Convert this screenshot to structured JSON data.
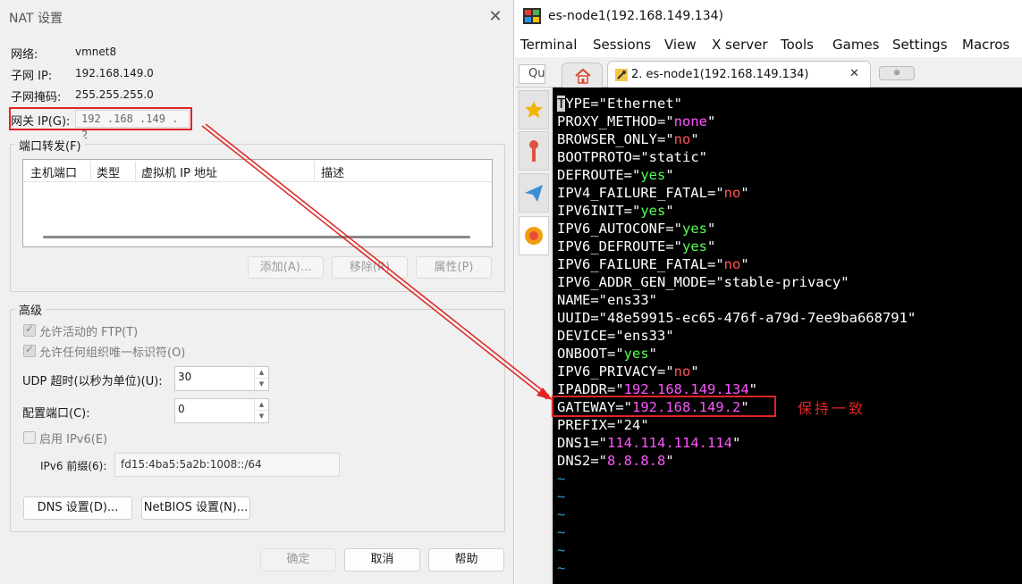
{
  "nat_dialog": {
    "title": "NAT 设置",
    "close_glyph": "✕",
    "network_label": "网络:",
    "network_value": "vmnet8",
    "subnet_ip_label": "子网 IP:",
    "subnet_ip_value": "192.168.149.0",
    "subnet_mask_label": "子网掩码:",
    "subnet_mask_value": "255.255.255.0",
    "gateway_label": "网关 IP(G):",
    "gateway_value": "192 .168 .149 . 2",
    "port_forward": {
      "group_title": "端口转发(F)",
      "columns": [
        "主机端口",
        "类型",
        "虚拟机 IP 地址",
        "描述"
      ],
      "add_button": "添加(A)...",
      "remove_button": "移除(R)",
      "properties_button": "属性(P)"
    },
    "advanced": {
      "group_title": "高级",
      "allow_ftp_label": "允许活动的 FTP(T)",
      "allow_ftp_checked": true,
      "allow_oui_label": "允许任何组织唯一标识符(O)",
      "allow_oui_checked": true,
      "udp_timeout_label": "UDP 超时(以秒为单位)(U):",
      "udp_timeout_value": "30",
      "config_port_label": "配置端口(C):",
      "config_port_value": "0",
      "enable_ipv6_label": "启用 IPv6(E)",
      "enable_ipv6_checked": false,
      "ipv6_prefix_label": "IPv6 前缀(6):",
      "ipv6_prefix_value": "fd15:4ba5:5a2b:1008::/64",
      "dns_button": "DNS 设置(D)...",
      "netbios_button": "NetBIOS 设置(N)..."
    },
    "ok_button": "确定",
    "cancel_button": "取消",
    "help_button": "帮助"
  },
  "moba": {
    "window_title": "es-node1(192.168.149.134)",
    "menu": [
      "Terminal",
      "Sessions",
      "View",
      "X server",
      "Tools",
      "Games",
      "Settings",
      "Macros"
    ],
    "quick_connect": "Qu",
    "active_tab_label": "2. es-node1(192.168.149.134)",
    "tab_close_glyph": "✕",
    "new_tab_glyph": "⊕",
    "terminal_lines": [
      {
        "key": "TYPE=",
        "val": "\"Ethernet\"",
        "color": "#ffffff"
      },
      {
        "key": "PROXY_METHOD=",
        "val": "\"none\"",
        "color": "#ff55ff",
        "quote_white": true
      },
      {
        "key": "BROWSER_ONLY=",
        "val": "\"no\"",
        "color": "#ff5555",
        "quote_white": true
      },
      {
        "key": "BOOTPROTO=",
        "val": "\"static\"",
        "color": "#ffffff"
      },
      {
        "key": "DEFROUTE=",
        "val": "\"yes\"",
        "color": "#55ff55",
        "quote_white": true
      },
      {
        "key": "IPV4_FAILURE_FATAL=",
        "val": "\"no\"",
        "color": "#ff5555",
        "quote_white": true
      },
      {
        "key": "IPV6INIT=",
        "val": "\"yes\"",
        "color": "#55ff55",
        "quote_white": true
      },
      {
        "key": "IPV6_AUTOCONF=",
        "val": "\"yes\"",
        "color": "#55ff55",
        "quote_white": true
      },
      {
        "key": "IPV6_DEFROUTE=",
        "val": "\"yes\"",
        "color": "#55ff55",
        "quote_white": true
      },
      {
        "key": "IPV6_FAILURE_FATAL=",
        "val": "\"no\"",
        "color": "#ff5555",
        "quote_white": true
      },
      {
        "key": "IPV6_ADDR_GEN_MODE=",
        "val": "\"stable-privacy\"",
        "color": "#ffffff"
      },
      {
        "key": "NAME=",
        "val": "\"ens33\"",
        "color": "#ffffff"
      },
      {
        "key": "UUID=",
        "val": "\"48e59915-ec65-476f-a79d-7ee9ba668791\"",
        "color": "#ffffff"
      },
      {
        "key": "DEVICE=",
        "val": "\"ens33\"",
        "color": "#ffffff"
      },
      {
        "key": "ONBOOT=",
        "val": "\"yes\"",
        "color": "#55ff55",
        "quote_white": true
      },
      {
        "key": "IPV6_PRIVACY=",
        "val": "\"no\"",
        "color": "#ff5555",
        "quote_white": true
      },
      {
        "key": "IPADDR=",
        "val": "\"192.168.149.134\"",
        "color": "#ff55ff",
        "quote_white": true
      },
      {
        "key": "GATEWAY=",
        "val": "\"192.168.149.2\"",
        "color": "#ff55ff",
        "quote_white": true
      },
      {
        "key": "PREFIX=",
        "val": "\"24\"",
        "color": "#ffffff"
      },
      {
        "key": "DNS1=",
        "val": "\"114.114.114.114\"",
        "color": "#ff55ff",
        "quote_white": true
      },
      {
        "key": "DNS2=",
        "val": "\"8.8.8.8\"",
        "color": "#ff55ff",
        "quote_white": true
      }
    ],
    "tilde_lines": [
      "~",
      "~",
      "~",
      "~",
      "~",
      "~"
    ],
    "tilde_color": "#2b9fd8"
  },
  "annotation": "保持一致",
  "highlight_color": "#e02424"
}
